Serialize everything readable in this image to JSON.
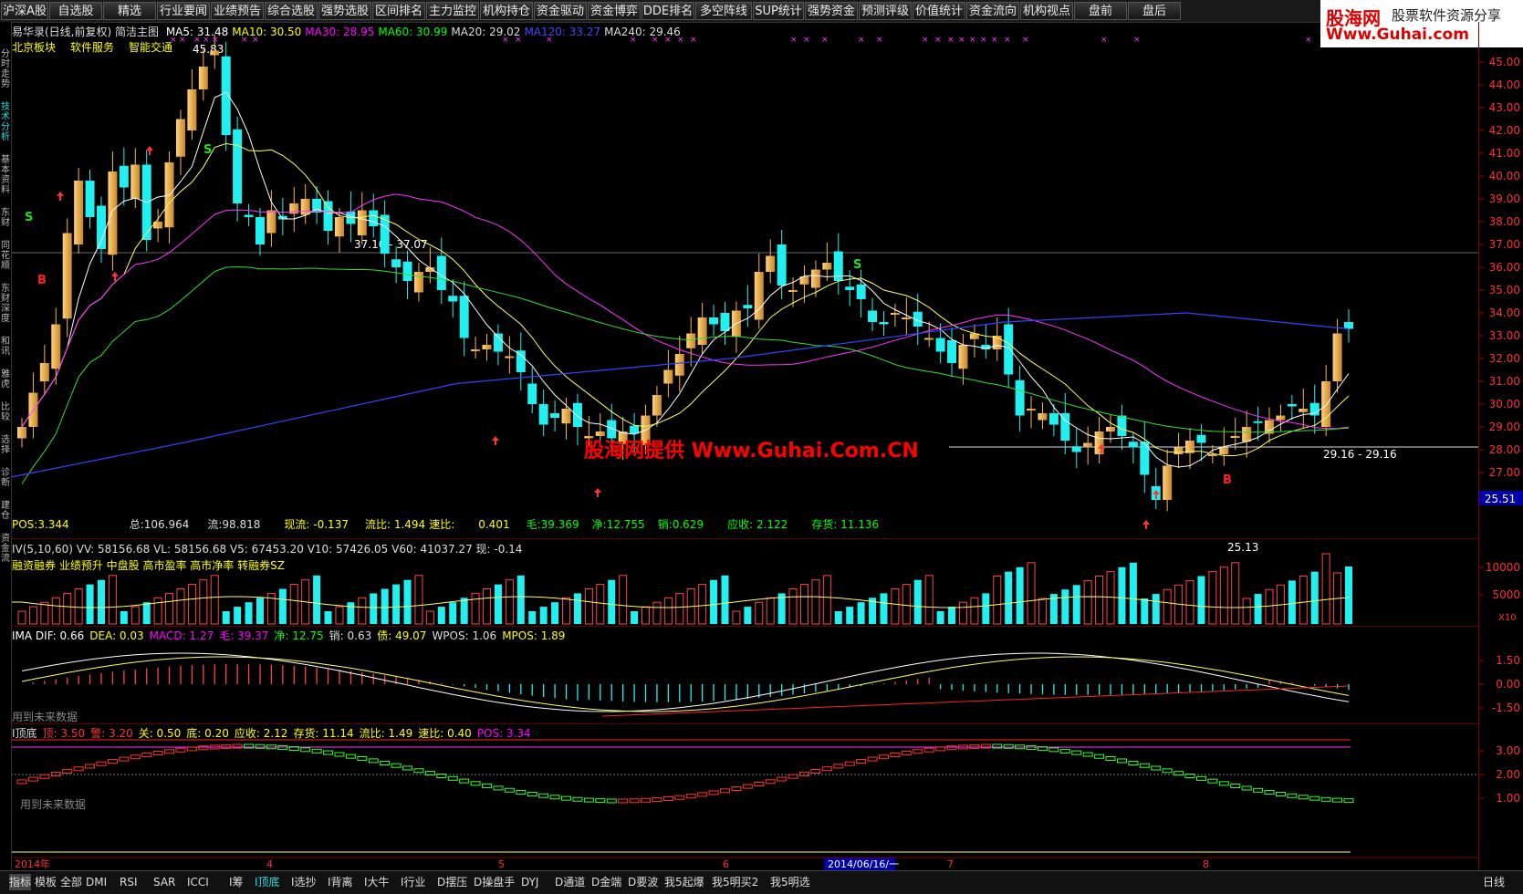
{
  "topbar": {
    "buttons": [
      "沪深A股",
      "自选股",
      "精选",
      "行业要闻",
      "业绩预告",
      "综合选股",
      "强势选股",
      "区间排名",
      "主力监控",
      "机构持仓",
      "资金驱动",
      "资金博弈",
      "DDE排名",
      "多空阵线",
      "SUP统计",
      "强势资金",
      "预测评级",
      "价值统计",
      "资金流向",
      "机构视点",
      "盘前",
      "盘后"
    ]
  },
  "logo": {
    "name": "股海网",
    "slogan": "股票软件资源分享",
    "url": "Www.Guhai.com"
  },
  "watermark": "股海网提供 Www.Guhai.Com.CN",
  "left_tabs": [
    "分时走势",
    "技术分析",
    "基本资料",
    "东财",
    "同花顺",
    "东财深度",
    "和讯",
    "雅虎",
    "比较",
    "选择",
    "诊断",
    "建仓",
    "资金流"
  ],
  "main": {
    "title": "易华录(日线,前复权) 简洁主图",
    "ma": [
      {
        "label": "MA5: 31.48",
        "color": "#ffffff"
      },
      {
        "label": "MA10: 30.50",
        "color": "#ffff00"
      },
      {
        "label": "MA30: 28.95",
        "color": "#ff00ff"
      },
      {
        "label": "MA60: 30.99",
        "color": "#00ff00"
      },
      {
        "label": "MA20: 29.02",
        "color": "#dddddd"
      },
      {
        "label": "MA120: 33.27",
        "color": "#4444ff"
      },
      {
        "label": "MA240: 29.46",
        "color": "#dddddd"
      }
    ],
    "concepts": [
      "北京板块",
      "软件服务",
      "智能交通"
    ],
    "stats": [
      {
        "label": "POS:3.344",
        "color": "#ffff00"
      },
      {
        "label": "总:106.964",
        "color": "#dddddd"
      },
      {
        "label": "流:98.818",
        "color": "#dddddd"
      },
      {
        "label": "现流: -0.137",
        "color": "#ffff00"
      },
      {
        "label": "流比: 1.494",
        "color": "#ffff00"
      },
      {
        "label": "速比:",
        "color": "#ffff00"
      },
      {
        "label": "0.401",
        "color": "#ffff00"
      },
      {
        "label": "毛:39.369",
        "color": "#00ff00"
      },
      {
        "label": "净:12.755",
        "color": "#00ff00"
      },
      {
        "label": "销:0.629",
        "color": "#00ff00"
      },
      {
        "label": "应收: 2.122",
        "color": "#00ff00"
      },
      {
        "label": "存货: 11.136",
        "color": "#00ff00"
      }
    ],
    "annotations": {
      "high": "45.83",
      "low": "25.13",
      "level1": "37.10 - 37.07",
      "level2": "29.16 - 29.16",
      "price_tag": "25.51"
    },
    "yticks": [
      "45.00",
      "44.00",
      "43.00",
      "42.00",
      "41.00",
      "40.00",
      "39.00",
      "38.00",
      "37.00",
      "36.00",
      "35.00",
      "34.00",
      "33.00",
      "32.00",
      "31.00",
      "30.00",
      "29.00",
      "28.00",
      "27.00"
    ]
  },
  "volume": {
    "legend": "IV(5,10,60)  VV: 58156.68  VL: 58156.68  V5: 67453.20  V10: 57426.05  V60: 41037.27  现: -0.14",
    "tags": "融资融券 业绩预升 中盘股 高市盈率 高市净率 转融券SZ",
    "yticks": [
      "10000",
      "5000"
    ],
    "unit": "X10"
  },
  "macd": {
    "legend": [
      {
        "label": "IMA DIF: 0.66",
        "color": "#ffffff"
      },
      {
        "label": "DEA: 0.03",
        "color": "#ffff00"
      },
      {
        "label": "MACD: 1.27",
        "color": "#ff00ff"
      },
      {
        "label": "毛: 39.37",
        "color": "#ff00ff"
      },
      {
        "label": "净: 12.75",
        "color": "#00ff00"
      },
      {
        "label": "销: 0.63",
        "color": "#dddddd"
      },
      {
        "label": "债: 49.07",
        "color": "#ffff00"
      },
      {
        "label": "WPOS: 1.06",
        "color": "#dddddd"
      },
      {
        "label": "MPOS: 1.89",
        "color": "#ffff00"
      }
    ],
    "note": "用到未来数据",
    "yticks": [
      "1.50",
      "0.00",
      "-1.50"
    ]
  },
  "bottom_ind": {
    "legend": [
      {
        "label": "I顶底",
        "color": "#dddddd"
      },
      {
        "label": "顶: 3.50",
        "color": "#ff3333"
      },
      {
        "label": "警: 3.20",
        "color": "#ff3333"
      },
      {
        "label": "关: 0.50",
        "color": "#ffff00"
      },
      {
        "label": "底: 0.20",
        "color": "#ffff00"
      },
      {
        "label": "应收: 2.12",
        "color": "#ffff00"
      },
      {
        "label": "存货: 11.14",
        "color": "#ffff00"
      },
      {
        "label": "流比: 1.49",
        "color": "#ffff00"
      },
      {
        "label": "速比: 0.40",
        "color": "#ffff00"
      },
      {
        "label": "POS: 3.34",
        "color": "#ff00ff"
      }
    ],
    "note": "用到未来数据",
    "yticks": [
      "3.00",
      "2.00",
      "1.00"
    ]
  },
  "xaxis": {
    "labels": [
      "2014年",
      "4",
      "5",
      "6",
      "2014/06/16/一",
      "7",
      "8"
    ],
    "period": "日线"
  },
  "bottom_tabs": [
    "指标",
    "模板",
    "全部",
    "DMI",
    "RSI",
    "SAR",
    "ICCI",
    "I筹",
    "I顶底",
    "I选抄",
    "I背离",
    "I大牛",
    "I行业",
    "D摆压",
    "D操盘手",
    "DYJ",
    "D通道",
    "D金端",
    "D要波",
    "我5起爆",
    "我5明买2",
    "我5明选"
  ]
}
